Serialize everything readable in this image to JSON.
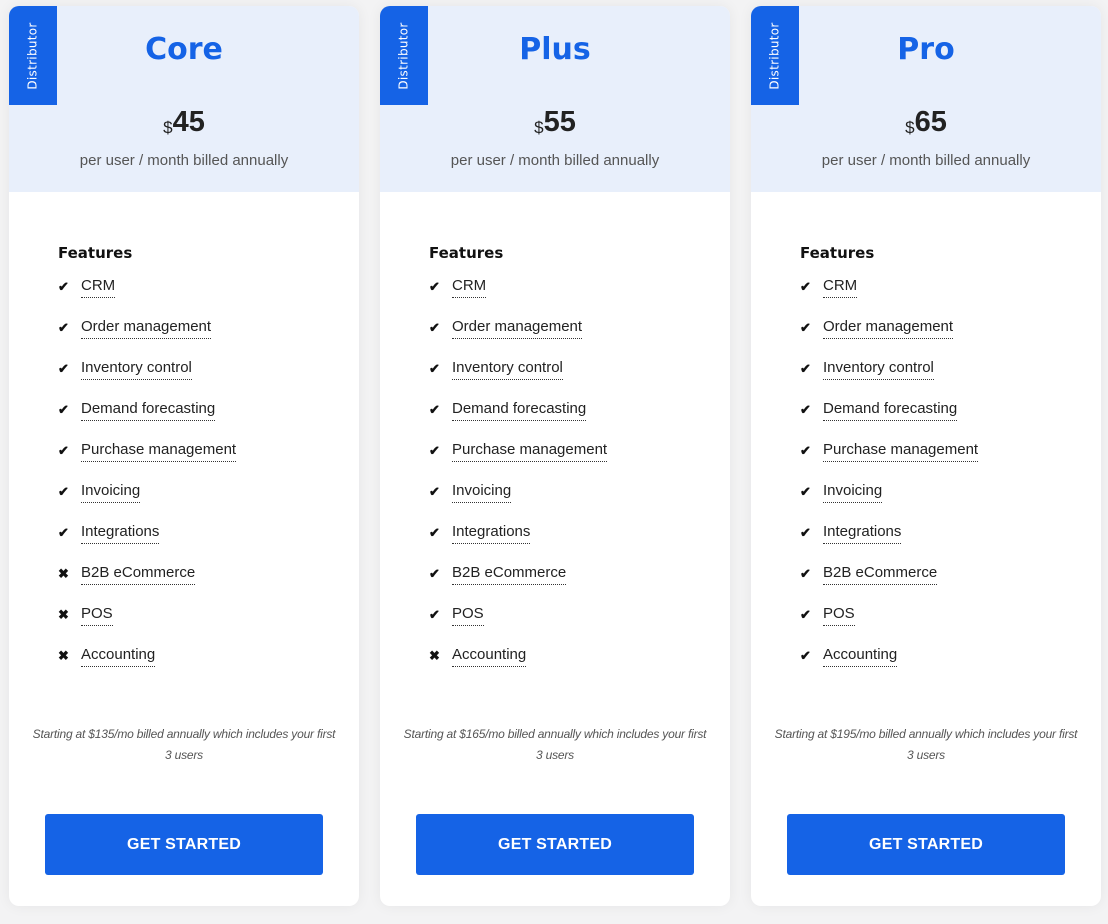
{
  "colors": {
    "accent": "#1563e6",
    "header_bg": "#e8effb"
  },
  "plans": [
    {
      "badge": "Distributor",
      "name": "Core",
      "currency": "$",
      "price": "45",
      "period": "per user / month billed annually",
      "features_title": "Features",
      "features": [
        {
          "label": "CRM",
          "included": true,
          "icon": "check-icon"
        },
        {
          "label": "Order management",
          "included": true,
          "icon": "check-icon"
        },
        {
          "label": "Inventory control",
          "included": true,
          "icon": "check-icon"
        },
        {
          "label": "Demand forecasting",
          "included": true,
          "icon": "check-icon"
        },
        {
          "label": "Purchase management",
          "included": true,
          "icon": "check-icon"
        },
        {
          "label": "Invoicing",
          "included": true,
          "icon": "check-icon"
        },
        {
          "label": "Integrations",
          "included": true,
          "icon": "check-icon"
        },
        {
          "label": "B2B eCommerce",
          "included": false,
          "icon": "x-icon"
        },
        {
          "label": "POS",
          "included": false,
          "icon": "x-icon"
        },
        {
          "label": "Accounting",
          "included": false,
          "icon": "x-icon"
        }
      ],
      "note": "Starting at $135/mo billed annually which includes your first 3 users",
      "cta": "GET STARTED"
    },
    {
      "badge": "Distributor",
      "name": "Plus",
      "currency": "$",
      "price": "55",
      "period": "per user / month billed annually",
      "features_title": "Features",
      "features": [
        {
          "label": "CRM",
          "included": true,
          "icon": "check-icon"
        },
        {
          "label": "Order management",
          "included": true,
          "icon": "check-icon"
        },
        {
          "label": "Inventory control",
          "included": true,
          "icon": "check-icon"
        },
        {
          "label": "Demand forecasting",
          "included": true,
          "icon": "check-icon"
        },
        {
          "label": "Purchase management",
          "included": true,
          "icon": "check-icon"
        },
        {
          "label": "Invoicing",
          "included": true,
          "icon": "check-icon"
        },
        {
          "label": "Integrations",
          "included": true,
          "icon": "check-icon"
        },
        {
          "label": "B2B eCommerce",
          "included": true,
          "icon": "check-icon"
        },
        {
          "label": "POS",
          "included": true,
          "icon": "check-icon"
        },
        {
          "label": "Accounting",
          "included": false,
          "icon": "x-icon"
        }
      ],
      "note": "Starting at $165/mo billed annually which includes your first 3 users",
      "cta": "GET STARTED"
    },
    {
      "badge": "Distributor",
      "name": "Pro",
      "currency": "$",
      "price": "65",
      "period": "per user / month billed annually",
      "features_title": "Features",
      "features": [
        {
          "label": "CRM",
          "included": true,
          "icon": "check-icon"
        },
        {
          "label": "Order management",
          "included": true,
          "icon": "check-icon"
        },
        {
          "label": "Inventory control",
          "included": true,
          "icon": "check-icon"
        },
        {
          "label": "Demand forecasting",
          "included": true,
          "icon": "check-icon"
        },
        {
          "label": "Purchase management",
          "included": true,
          "icon": "check-icon"
        },
        {
          "label": "Invoicing",
          "included": true,
          "icon": "check-icon"
        },
        {
          "label": "Integrations",
          "included": true,
          "icon": "check-icon"
        },
        {
          "label": "B2B eCommerce",
          "included": true,
          "icon": "check-icon"
        },
        {
          "label": "POS",
          "included": true,
          "icon": "check-icon"
        },
        {
          "label": "Accounting",
          "included": true,
          "icon": "check-icon"
        }
      ],
      "note": "Starting at $195/mo billed annually which includes your first 3 users",
      "cta": "GET STARTED"
    }
  ]
}
